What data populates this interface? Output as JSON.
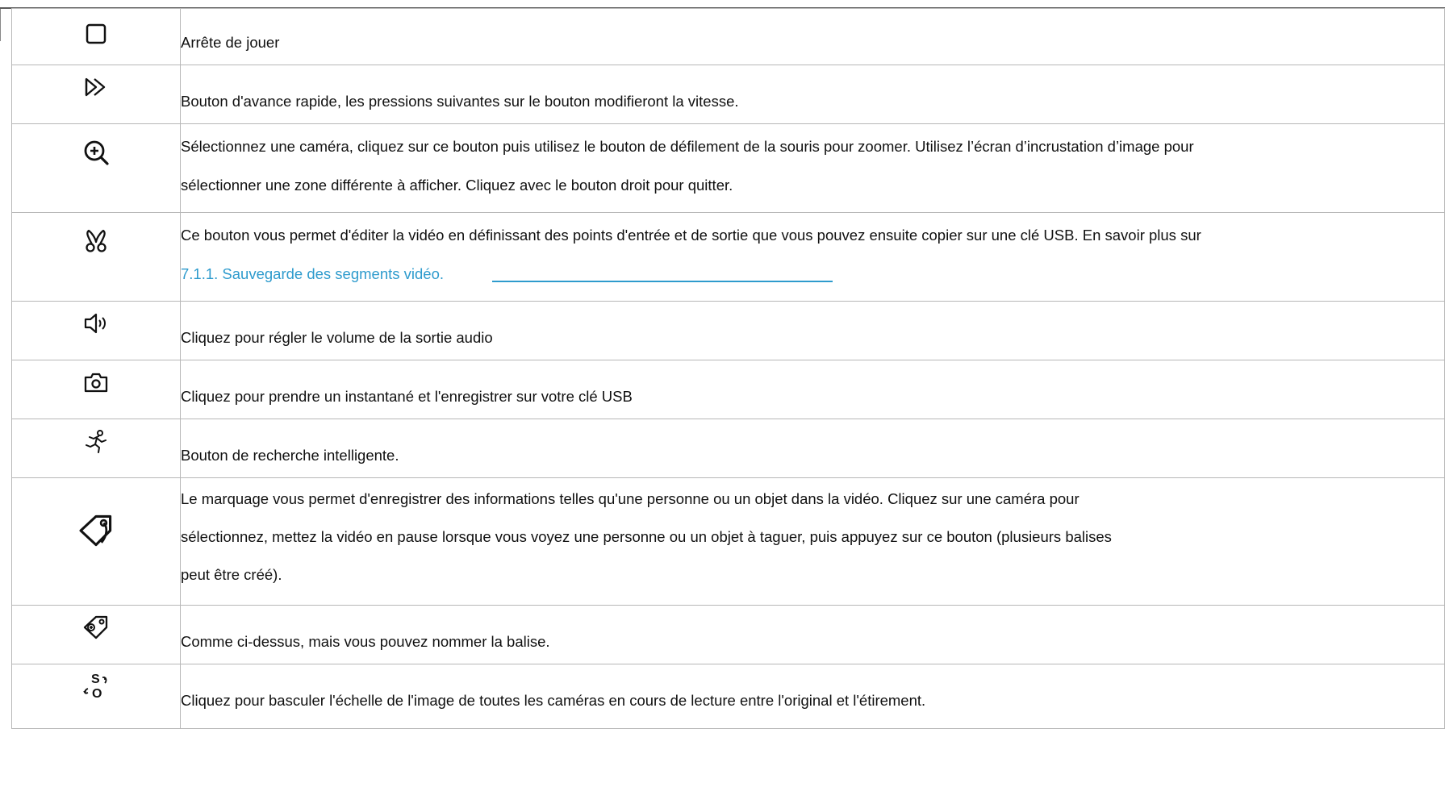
{
  "rows": [
    {
      "icon": "stop-icon",
      "lines": [
        "Arrête de jouer"
      ]
    },
    {
      "icon": "fast-forward-icon",
      "lines": [
        "Bouton d'avance rapide, les pressions suivantes sur le bouton modifieront la vitesse."
      ]
    },
    {
      "icon": "zoom-in-icon",
      "lines": [
        "Sélectionnez une caméra, cliquez sur ce bouton puis utilisez le bouton de défilement de la souris pour zoomer. Utilisez l’écran d’incrustation d’image pour",
        "sélectionner une zone différente à afficher. Cliquez avec le bouton droit pour quitter."
      ]
    },
    {
      "icon": "scissors-icon",
      "lines": [
        "Ce bouton vous permet d'éditer la vidéo en définissant des points d'entrée et de sortie que vous pouvez ensuite copier sur une clé USB. En savoir plus sur"
      ],
      "link": "7.1.1. Sauvegarde des segments vidéo."
    },
    {
      "icon": "volume-icon",
      "lines": [
        "Cliquez pour régler le volume de la sortie audio"
      ]
    },
    {
      "icon": "camera-icon",
      "lines": [
        "Cliquez pour prendre un instantané et l'enregistrer sur votre clé USB"
      ]
    },
    {
      "icon": "smart-search-icon",
      "lines": [
        "Bouton de recherche intelligente."
      ]
    },
    {
      "icon": "tag-icon",
      "lines": [
        "Le marquage vous permet d'enregistrer des informations telles qu'une personne ou un objet dans la vidéo. Cliquez sur une caméra pour",
        "sélectionnez, mettez la vidéo en pause lorsque vous voyez une personne ou un objet à taguer, puis appuyez sur ce bouton (plusieurs balises",
        "peut être créé)."
      ]
    },
    {
      "icon": "custom-tag-icon",
      "lines": [
        "Comme ci-dessus, mais vous pouvez nommer la balise."
      ]
    },
    {
      "icon": "scale-toggle-icon",
      "lines": [
        "Cliquez pour basculer l'échelle de l'image de toutes les caméras en cours de lecture entre l'original et l'étirement."
      ]
    }
  ],
  "colors": {
    "link": "#2e9bcd",
    "border": "#b7b7b7",
    "text": "#111111"
  }
}
